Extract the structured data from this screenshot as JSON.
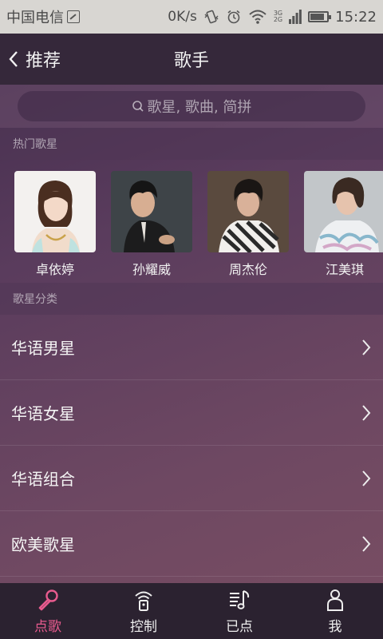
{
  "status_bar": {
    "carrier": "中国电信",
    "speed": "0K/s",
    "network_top": "3G",
    "network_bottom": "2G",
    "time": "15:22",
    "battery_level": 0.85
  },
  "header": {
    "back_label": "推荐",
    "title": "歌手"
  },
  "search": {
    "placeholder": "歌星, 歌曲, 简拼"
  },
  "hot_singers": {
    "heading": "热门歌星",
    "items": [
      {
        "name": "卓依婷"
      },
      {
        "name": "孙耀威"
      },
      {
        "name": "周杰伦"
      },
      {
        "name": "江美琪"
      }
    ]
  },
  "categories": {
    "heading": "歌星分类",
    "items": [
      {
        "label": "华语男星"
      },
      {
        "label": "华语女星"
      },
      {
        "label": "华语组合"
      },
      {
        "label": "欧美歌星"
      }
    ]
  },
  "bottom_nav": {
    "items": [
      {
        "label": "点歌",
        "icon": "microphone-icon",
        "active": true
      },
      {
        "label": "控制",
        "icon": "remote-icon",
        "active": false
      },
      {
        "label": "已点",
        "icon": "playlist-icon",
        "active": false
      },
      {
        "label": "我",
        "icon": "person-icon",
        "active": false
      }
    ]
  },
  "colors": {
    "accent": "#e85b8e",
    "title_bar": "#35283a",
    "nav_bar": "#2b2230"
  }
}
